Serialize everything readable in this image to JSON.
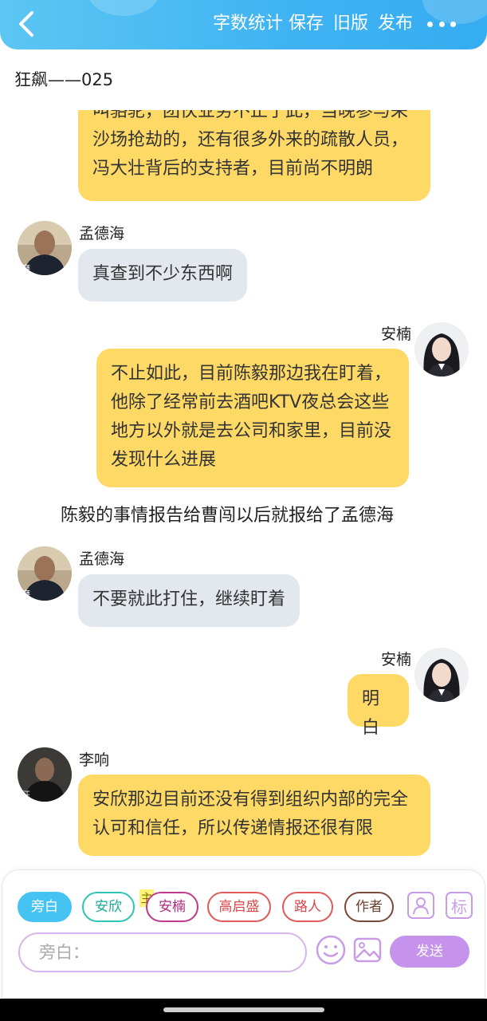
{
  "header": {
    "back_icon": "chevron-left-icon",
    "word_count": "字数统计",
    "save": "保存",
    "old_version": "旧版",
    "publish": "发布",
    "more_icon": "more-horizontal-icon",
    "bg_color": "#3fb3f2"
  },
  "story_title": "狂飙——025",
  "messages": {
    "m1": {
      "side": "right",
      "lines": [
        "叫骆驼，团伙业务不止于此，当晚参与采",
        "沙场抢劫的，还有很多外来的疏散人员，",
        "冯大壮背后的支持者，目前尚不明朗"
      ]
    },
    "m2": {
      "sender": "孟德海",
      "side": "left",
      "lines": [
        "真查到不少东西啊"
      ]
    },
    "m3": {
      "sender": "安楠",
      "side": "right",
      "lines": [
        "不止如此，目前陈毅那边我在盯着，",
        "他除了经常前去酒吧KTV夜总会这些",
        "地方以外就是去公司和家里，目前没",
        "发现什么进展"
      ]
    },
    "narration": "陈毅的事情报告给曹闯以后就报给了孟德海",
    "m4": {
      "sender": "孟德海",
      "side": "left",
      "lines": [
        "不要就此打住，继续盯着"
      ]
    },
    "m5": {
      "sender": "安楠",
      "side": "right",
      "lines": [
        "明白"
      ]
    },
    "m6": {
      "sender": "李响",
      "side": "left",
      "lines": [
        "安欣那边目前还没有得到组织内部的完全",
        "认可和信任，所以传递情报还很有限"
      ]
    }
  },
  "roles": {
    "narrator": "旁白",
    "anxin": "安欣",
    "annan": "安楠",
    "main_badge": "主",
    "gaoqisheng": "高启盛",
    "passerby": "路人",
    "author": "作者"
  },
  "tools": {
    "role_icon": "user-card-icon",
    "tag_label": "标"
  },
  "composer": {
    "placeholder": "旁白：",
    "emoji_icon": "smile-icon",
    "image_icon": "image-icon",
    "send": "发送",
    "send_color": "#c593ec"
  },
  "colors": {
    "own_bubble": "#ffd966",
    "other_bubble": "#e3e8ef",
    "active_chip": "#45c3f3"
  }
}
